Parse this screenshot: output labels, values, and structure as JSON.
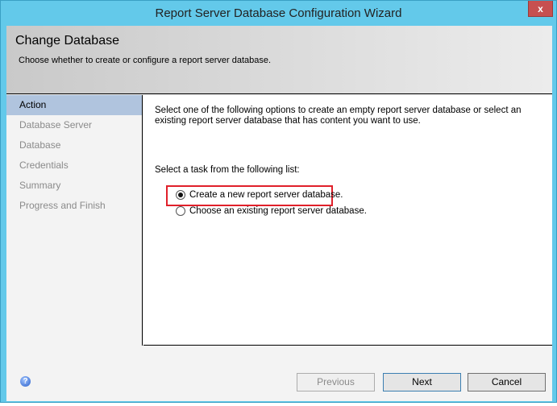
{
  "window": {
    "title": "Report Server Database Configuration Wizard",
    "close_label": "x"
  },
  "header": {
    "title": "Change Database",
    "subtitle": "Choose whether to create or configure a report server database."
  },
  "sidebar": {
    "items": [
      {
        "label": "Action",
        "active": true
      },
      {
        "label": "Database Server"
      },
      {
        "label": "Database"
      },
      {
        "label": "Credentials"
      },
      {
        "label": "Summary"
      },
      {
        "label": "Progress and Finish"
      }
    ]
  },
  "main": {
    "intro": "Select one of the following options to create an empty report server database or select an existing report server database that has content you want to use.",
    "task_label": "Select a task from the following list:",
    "options": [
      {
        "label": "Create a new report server database.",
        "selected": true
      },
      {
        "label": "Choose an existing report server database.",
        "selected": false
      }
    ]
  },
  "footer": {
    "help": "?",
    "previous": "Previous",
    "next": "Next",
    "cancel": "Cancel"
  }
}
